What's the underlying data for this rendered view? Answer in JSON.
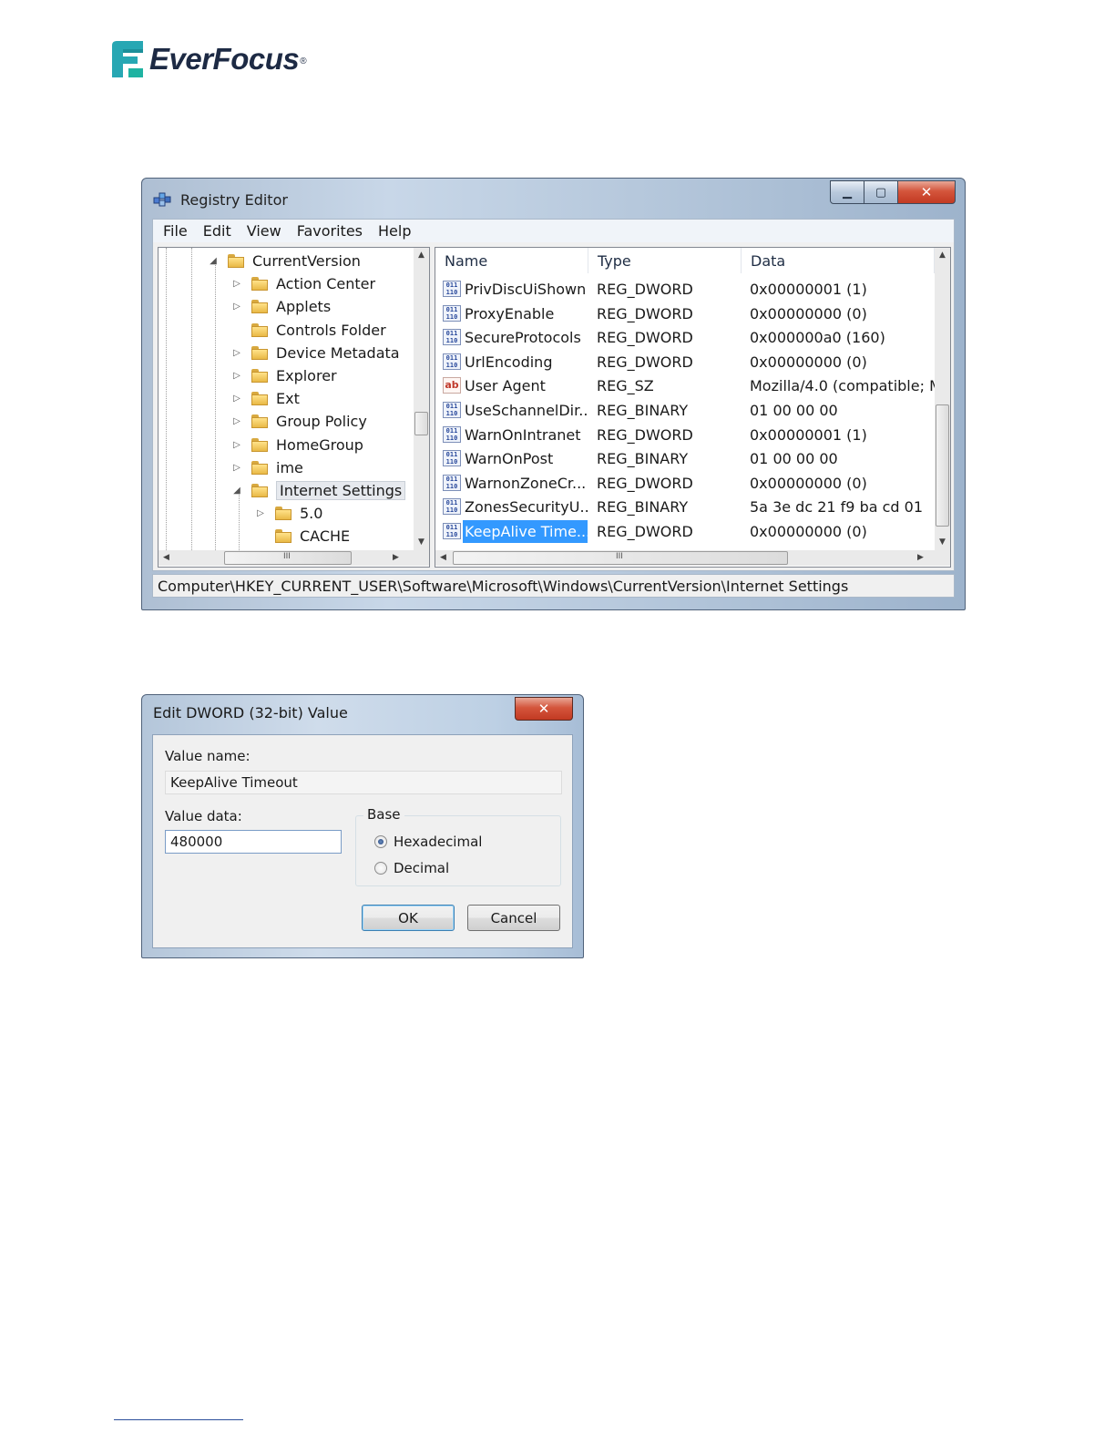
{
  "logo": {
    "text": "EverFocus",
    "registered": "®"
  },
  "registry_editor": {
    "title": "Registry Editor",
    "window_controls": {
      "minimize": "▁",
      "maximize": "▢",
      "close": "✕"
    },
    "menu": [
      "File",
      "Edit",
      "View",
      "Favorites",
      "Help"
    ],
    "tree": [
      {
        "label": "CurrentVersion",
        "twisty": "◢",
        "level": 0
      },
      {
        "label": "Action Center",
        "twisty": "▷",
        "level": 1
      },
      {
        "label": "Applets",
        "twisty": "▷",
        "level": 1
      },
      {
        "label": "Controls Folder",
        "twisty": "",
        "level": 1
      },
      {
        "label": "Device Metadata",
        "twisty": "▷",
        "level": 1
      },
      {
        "label": "Explorer",
        "twisty": "▷",
        "level": 1
      },
      {
        "label": "Ext",
        "twisty": "▷",
        "level": 1
      },
      {
        "label": "Group Policy",
        "twisty": "▷",
        "level": 1
      },
      {
        "label": "HomeGroup",
        "twisty": "▷",
        "level": 1
      },
      {
        "label": "ime",
        "twisty": "▷",
        "level": 1
      },
      {
        "label": "Internet Settings",
        "twisty": "◢",
        "level": 1,
        "selected": true
      },
      {
        "label": "5.0",
        "twisty": "▷",
        "level": 2
      },
      {
        "label": "CACHE",
        "twisty": "",
        "level": 2
      }
    ],
    "list_headers": {
      "name": "Name",
      "type": "Type",
      "data": "Data"
    },
    "values": [
      {
        "name": "PrivDiscUiShown",
        "type": "REG_DWORD",
        "data": "0x00000001 (1)",
        "icon": "binary-value-icon"
      },
      {
        "name": "ProxyEnable",
        "type": "REG_DWORD",
        "data": "0x00000000 (0)",
        "icon": "binary-value-icon"
      },
      {
        "name": "SecureProtocols",
        "type": "REG_DWORD",
        "data": "0x000000a0 (160)",
        "icon": "binary-value-icon"
      },
      {
        "name": "UrlEncoding",
        "type": "REG_DWORD",
        "data": "0x00000000 (0)",
        "icon": "binary-value-icon"
      },
      {
        "name": "User Agent",
        "type": "REG_SZ",
        "data": "Mozilla/4.0 (compatible; M",
        "icon": "string-value-icon"
      },
      {
        "name": "UseSchannelDir...",
        "type": "REG_BINARY",
        "data": "01 00 00 00",
        "icon": "binary-value-icon"
      },
      {
        "name": "WarnOnIntranet",
        "type": "REG_DWORD",
        "data": "0x00000001 (1)",
        "icon": "binary-value-icon"
      },
      {
        "name": "WarnOnPost",
        "type": "REG_BINARY",
        "data": "01 00 00 00",
        "icon": "binary-value-icon"
      },
      {
        "name": "WarnonZoneCr...",
        "type": "REG_DWORD",
        "data": "0x00000000 (0)",
        "icon": "binary-value-icon"
      },
      {
        "name": "ZonesSecurityU...",
        "type": "REG_BINARY",
        "data": "5a 3e dc 21 f9 ba cd 01",
        "icon": "binary-value-icon"
      },
      {
        "name": "KeepAlive Time...",
        "type": "REG_DWORD",
        "data": "0x00000000 (0)",
        "icon": "binary-value-icon",
        "selected": true
      }
    ],
    "icon_text": {
      "binary": "011\n110",
      "string": "ab"
    },
    "scroll_grip": "III",
    "status_path": "Computer\\HKEY_CURRENT_USER\\Software\\Microsoft\\Windows\\CurrentVersion\\Internet Settings"
  },
  "edit_dialog": {
    "title": "Edit DWORD (32-bit) Value",
    "close": "✕",
    "value_name_label": "Value name:",
    "value_name": "KeepAlive Timeout",
    "value_data_label": "Value data:",
    "value_data": "480000",
    "base_label": "Base",
    "base_options": [
      {
        "label": "Hexadecimal",
        "checked": true
      },
      {
        "label": "Decimal",
        "checked": false
      }
    ],
    "ok_label": "OK",
    "cancel_label": "Cancel"
  },
  "colors": {
    "selection": "#3399ff",
    "brand_teal": "#27a7b3",
    "brand_navy": "#1d2a44"
  }
}
